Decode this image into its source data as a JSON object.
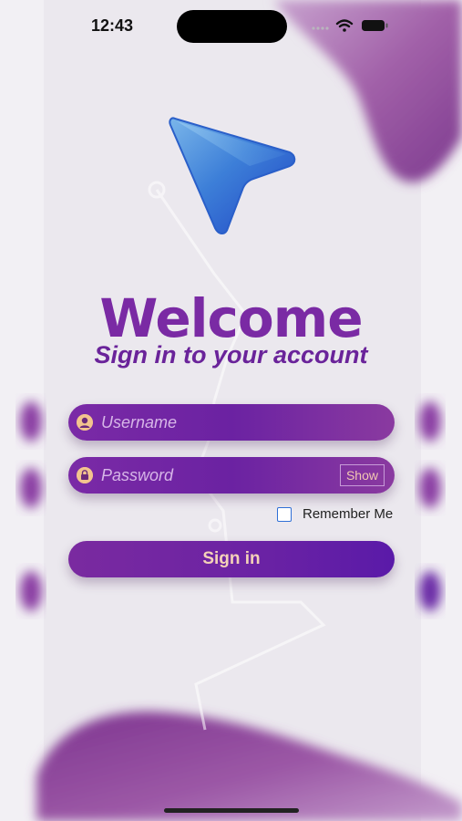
{
  "status_bar": {
    "time": "12:43",
    "icons": [
      "signal-dots-icon",
      "wifi-icon",
      "battery-icon"
    ]
  },
  "app": {
    "logo_icon": "navigation-arrow-icon",
    "title": "Welcome",
    "subtitle": "Sign in to your account"
  },
  "form": {
    "username": {
      "placeholder": "Username",
      "value": "",
      "icon": "user-icon"
    },
    "password": {
      "placeholder": "Password",
      "value": "",
      "icon": "lock-icon",
      "toggle_label": "Show"
    },
    "remember_me": {
      "label": "Remember Me",
      "checked": false
    },
    "submit_label": "Sign in"
  },
  "colors": {
    "accent_purple": "#7a2aa4",
    "field_text": "#d7b6e8",
    "button_text": "#f4d2b8",
    "checkbox_border": "#2f6fd6"
  }
}
